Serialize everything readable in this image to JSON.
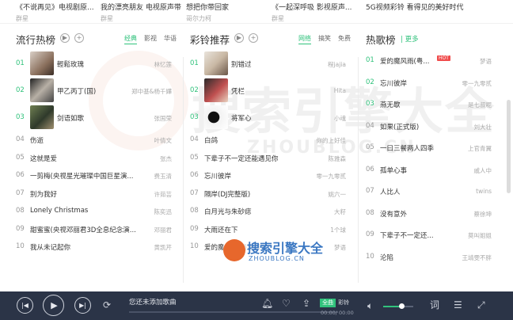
{
  "top_strip": [
    {
      "title": "《不说再见》电视剧原...",
      "sub": "群星"
    },
    {
      "title": "我的漂亮朋友 电视原声带",
      "sub": "群星"
    },
    {
      "title": "想把你带回家",
      "sub": "哥尔力柯"
    },
    {
      "title": "《一起深呼吸 影视原声...",
      "sub": "群星"
    },
    {
      "title": "5G视频彩铃 看得见的美好时代",
      "sub": ""
    }
  ],
  "col1": {
    "title": "流行热榜",
    "tabs": [
      {
        "label": "经典",
        "active": true
      },
      {
        "label": "影视",
        "active": false
      },
      {
        "label": "华语",
        "active": false
      }
    ],
    "rows": [
      {
        "num": "01",
        "name": "輕鬆玫瑰",
        "artist": "林忆莲"
      },
      {
        "num": "02",
        "name": "甲乙丙丁(国)",
        "artist": "郑中基&杨千嬅"
      },
      {
        "num": "03",
        "name": "剑语如歌",
        "artist": "张国荣"
      },
      {
        "num": "04",
        "name": "伤逝",
        "artist": "叶倩文"
      },
      {
        "num": "05",
        "name": "这就是爱",
        "artist": "张杰"
      },
      {
        "num": "06",
        "name": "一剪梅(央视星光璀璨中国巨星演...",
        "artist": "费玉清"
      },
      {
        "num": "07",
        "name": "别为我好",
        "artist": "许茹芸"
      },
      {
        "num": "08",
        "name": "Lonely Christmas",
        "artist": "陈奕迅"
      },
      {
        "num": "09",
        "name": "甜蜜蜜(央视邓丽君3D全息纪念演...",
        "artist": "邓丽君"
      },
      {
        "num": "10",
        "name": "我从未记起你",
        "artist": "黄凯芹"
      }
    ]
  },
  "col2": {
    "title": "彩铃推荐",
    "tabs": [
      {
        "label": "网络",
        "active": true
      },
      {
        "label": "搞笑",
        "active": false
      },
      {
        "label": "免费",
        "active": false
      }
    ],
    "rows": [
      {
        "num": "01",
        "name": "别错过",
        "artist": "程jajia"
      },
      {
        "num": "02",
        "name": "凭栏",
        "artist": "Hita"
      },
      {
        "num": "03",
        "name": "将军心",
        "artist": "小魂"
      },
      {
        "num": "04",
        "name": "白鸽",
        "artist": "你的上好佳"
      },
      {
        "num": "05",
        "name": "下辈子不一定还能遇见你",
        "artist": "陈雅森"
      },
      {
        "num": "06",
        "name": "忘川彼岸",
        "artist": "零一九零贰"
      },
      {
        "num": "07",
        "name": "隔岸(DJ完整版)",
        "artist": "姚六一"
      },
      {
        "num": "08",
        "name": "白月光与朱砂痣",
        "artist": "大籽"
      },
      {
        "num": "09",
        "name": "大雨还在下",
        "artist": "1个球"
      },
      {
        "num": "10",
        "name": "爱的魔风雨(粤语版)",
        "artist": "梦语"
      }
    ]
  },
  "col3": {
    "title": "热歌榜",
    "more": "更多",
    "badge": "HOT",
    "rows": [
      {
        "num": "01",
        "name": "爱的魔风雨(粤...",
        "artist": "梦语"
      },
      {
        "num": "02",
        "name": "忘川彼岸",
        "artist": "零一九零贰"
      },
      {
        "num": "03",
        "name": "燕无歇",
        "artist": "是七叔呢"
      },
      {
        "num": "04",
        "name": "如果(正式版)",
        "artist": "刘大壮"
      },
      {
        "num": "05",
        "name": "一曰三餐两人四季",
        "artist": "上官青翼"
      },
      {
        "num": "06",
        "name": "孤单心事",
        "artist": "戚人中"
      },
      {
        "num": "07",
        "name": "人比人",
        "artist": "twins"
      },
      {
        "num": "08",
        "name": "没有意外",
        "artist": "蔡徐坤"
      },
      {
        "num": "09",
        "name": "下辈子不一定还...",
        "artist": "莫叫姐姐"
      },
      {
        "num": "10",
        "name": "沦陷",
        "artist": "王靖雯不胖"
      }
    ]
  },
  "watermark": {
    "main": "搜索引擎大全",
    "sub": "ZHOUBLOG.CN",
    "logo_main": "搜索引擎大全",
    "logo_sub": "ZHOUBLOG.CN"
  },
  "player": {
    "status": "您还未添加歌曲",
    "time": "00:00/ 00:00",
    "toggle_on": "全曲",
    "toggle_off": "彩铃",
    "lyrics_label": "词",
    "volume_percent": 60
  }
}
